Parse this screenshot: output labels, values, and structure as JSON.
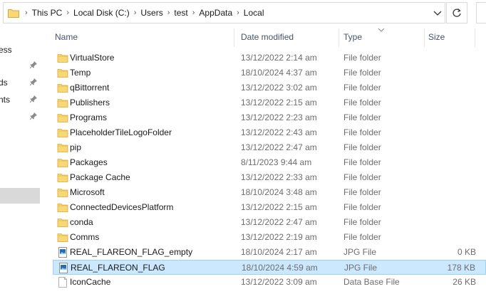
{
  "address": {
    "crumbs": [
      "This PC",
      "Local Disk (C:)",
      "Users",
      "test",
      "AppData",
      "Local"
    ]
  },
  "nav": {
    "items": [
      {
        "label": "ess",
        "pinned": false
      },
      {
        "label": "ds",
        "pinned": true
      },
      {
        "label": "nts",
        "pinned": true
      }
    ]
  },
  "columns": {
    "name": "Name",
    "date": "Date modified",
    "type": "Type",
    "size": "Size"
  },
  "files": [
    {
      "name": "VirtualStore",
      "date": "13/12/2022 2:14 am",
      "type": "File folder",
      "size": "",
      "icon": "folder-icon"
    },
    {
      "name": "Temp",
      "date": "18/10/2024 4:37 am",
      "type": "File folder",
      "size": "",
      "icon": "folder-icon"
    },
    {
      "name": "qBittorrent",
      "date": "13/12/2022 3:02 am",
      "type": "File folder",
      "size": "",
      "icon": "folder-icon"
    },
    {
      "name": "Publishers",
      "date": "13/12/2022 2:15 am",
      "type": "File folder",
      "size": "",
      "icon": "folder-icon"
    },
    {
      "name": "Programs",
      "date": "13/12/2022 2:23 am",
      "type": "File folder",
      "size": "",
      "icon": "folder-icon"
    },
    {
      "name": "PlaceholderTileLogoFolder",
      "date": "13/12/2022 2:43 am",
      "type": "File folder",
      "size": "",
      "icon": "folder-icon"
    },
    {
      "name": "pip",
      "date": "13/12/2022 2:47 am",
      "type": "File folder",
      "size": "",
      "icon": "folder-icon"
    },
    {
      "name": "Packages",
      "date": "8/11/2023 9:44 am",
      "type": "File folder",
      "size": "",
      "icon": "folder-icon"
    },
    {
      "name": "Package Cache",
      "date": "13/12/2022 2:33 am",
      "type": "File folder",
      "size": "",
      "icon": "folder-icon"
    },
    {
      "name": "Microsoft",
      "date": "18/10/2024 3:48 am",
      "type": "File folder",
      "size": "",
      "icon": "folder-icon"
    },
    {
      "name": "ConnectedDevicesPlatform",
      "date": "13/12/2022 2:15 am",
      "type": "File folder",
      "size": "",
      "icon": "folder-icon"
    },
    {
      "name": "conda",
      "date": "13/12/2022 2:47 am",
      "type": "File folder",
      "size": "",
      "icon": "folder-icon"
    },
    {
      "name": "Comms",
      "date": "13/12/2022 2:19 am",
      "type": "File folder",
      "size": "",
      "icon": "folder-icon"
    },
    {
      "name": "REAL_FLAREON_FLAG_empty",
      "date": "18/10/2024 2:17 am",
      "type": "JPG File",
      "size": "0 KB",
      "icon": "image-file-icon"
    },
    {
      "name": "REAL_FLAREON_FLAG",
      "date": "18/10/2024 4:59 am",
      "type": "JPG File",
      "size": "178 KB",
      "icon": "image-file-icon",
      "selected": true
    },
    {
      "name": "IconCache",
      "date": "13/12/2022 3:09 am",
      "type": "Data Base File",
      "size": "26 KB",
      "icon": "database-file-icon"
    }
  ],
  "colors": {
    "folder": "#f8d775",
    "selection": "#cce8ff",
    "selection_border": "#99d1ff",
    "header_text": "#44546a"
  }
}
